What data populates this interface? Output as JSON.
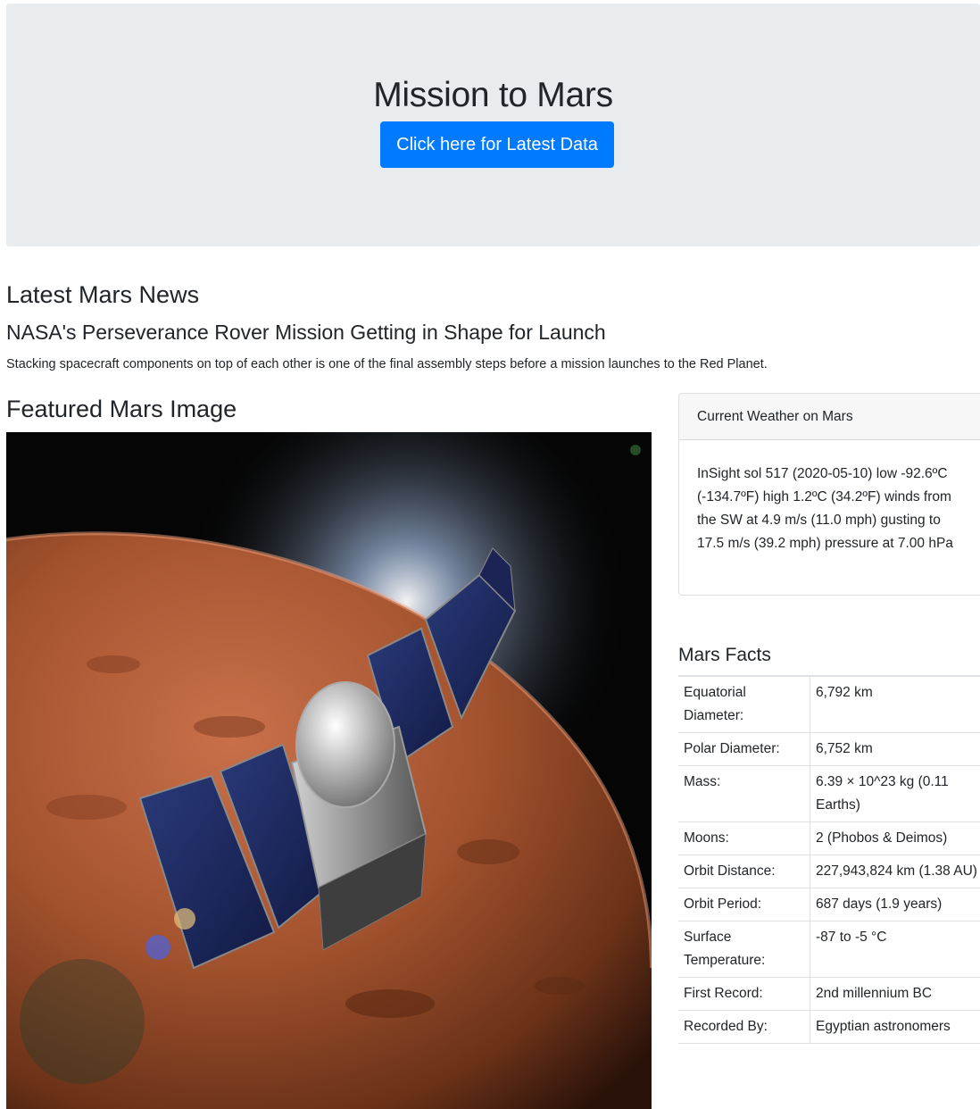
{
  "header": {
    "title": "Mission to Mars",
    "button_label": "Click here for Latest Data"
  },
  "news": {
    "heading": "Latest Mars News",
    "title": "NASA's Perseverance Rover Mission Getting in Shape for Launch",
    "paragraph": "Stacking spacecraft components on top of each other is one of the final assembly steps before a mission launches to the Red Planet."
  },
  "featured_image": {
    "heading": "Featured Mars Image",
    "subject": "spacecraft orbiting Mars"
  },
  "weather": {
    "header": "Current Weather on Mars",
    "body": "InSight sol 517 (2020-05-10) low -92.6ºC (-134.7ºF) high 1.2ºC (34.2ºF) winds from the SW at 4.9 m/s (11.0 mph) gusting to 17.5 m/s (39.2 mph) pressure at 7.00 hPa"
  },
  "facts": {
    "heading": "Mars Facts",
    "rows": [
      {
        "label": "Equatorial Diameter:",
        "value": "6,792 km"
      },
      {
        "label": "Polar Diameter:",
        "value": "6,752 km"
      },
      {
        "label": "Mass:",
        "value": "6.39 × 10^23 kg (0.11 Earths)"
      },
      {
        "label": "Moons:",
        "value": "2 (Phobos & Deimos)"
      },
      {
        "label": "Orbit Distance:",
        "value": "227,943,824 km (1.38 AU)"
      },
      {
        "label": "Orbit Period:",
        "value": "687 days (1.9 years)"
      },
      {
        "label": "Surface Temperature:",
        "value": "-87 to -5 °C"
      },
      {
        "label": "First Record:",
        "value": "2nd millennium BC"
      },
      {
        "label": "Recorded By:",
        "value": "Egyptian astronomers"
      }
    ]
  },
  "colors": {
    "jumbotron_bg": "#e9ecef",
    "primary_button": "#007bff"
  }
}
